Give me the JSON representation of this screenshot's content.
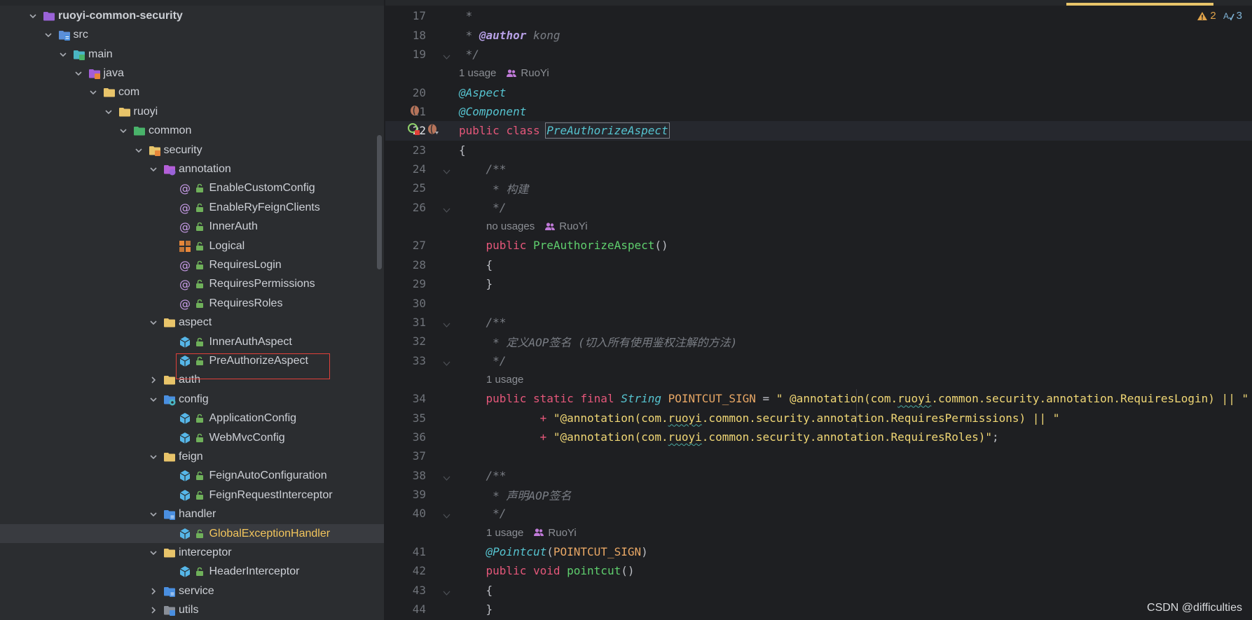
{
  "project_tree": {
    "rows": [
      {
        "depth": 2,
        "expanded": true,
        "icon": "module-icon",
        "label": "ruoyi-common-security",
        "bold": true
      },
      {
        "depth": 3,
        "expanded": true,
        "icon": "source-root-icon",
        "label": "src"
      },
      {
        "depth": 4,
        "expanded": true,
        "icon": "folder-main-icon",
        "label": "main"
      },
      {
        "depth": 5,
        "expanded": true,
        "icon": "java-source-icon",
        "label": "java"
      },
      {
        "depth": 6,
        "expanded": true,
        "icon": "package-icon",
        "label": "com"
      },
      {
        "depth": 7,
        "expanded": true,
        "icon": "package-icon",
        "label": "ruoyi"
      },
      {
        "depth": 8,
        "expanded": true,
        "icon": "module-package-icon",
        "label": "common"
      },
      {
        "depth": 9,
        "expanded": true,
        "icon": "security-package-icon",
        "label": "security"
      },
      {
        "depth": 10,
        "expanded": true,
        "icon": "annotation-package-icon",
        "label": "annotation"
      },
      {
        "depth": 11,
        "expanded": null,
        "icon": "annotation-icon",
        "label": "EnableCustomConfig",
        "lock": true
      },
      {
        "depth": 11,
        "expanded": null,
        "icon": "annotation-icon",
        "label": "EnableRyFeignClients",
        "lock": true
      },
      {
        "depth": 11,
        "expanded": null,
        "icon": "annotation-icon",
        "label": "InnerAuth",
        "lock": true
      },
      {
        "depth": 11,
        "expanded": null,
        "icon": "enum-icon",
        "label": "Logical",
        "lock": true
      },
      {
        "depth": 11,
        "expanded": null,
        "icon": "annotation-icon",
        "label": "RequiresLogin",
        "lock": true
      },
      {
        "depth": 11,
        "expanded": null,
        "icon": "annotation-icon",
        "label": "RequiresPermissions",
        "lock": true
      },
      {
        "depth": 11,
        "expanded": null,
        "icon": "annotation-icon",
        "label": "RequiresRoles",
        "lock": true
      },
      {
        "depth": 10,
        "expanded": true,
        "icon": "package-icon",
        "label": "aspect"
      },
      {
        "depth": 11,
        "expanded": null,
        "icon": "aspect-class-icon",
        "label": "InnerAuthAspect",
        "lock": true
      },
      {
        "depth": 11,
        "expanded": null,
        "icon": "aspect-class-icon",
        "label": "PreAuthorizeAspect",
        "lock": true
      },
      {
        "depth": 10,
        "expanded": false,
        "icon": "package-icon",
        "label": "auth"
      },
      {
        "depth": 10,
        "expanded": true,
        "icon": "config-package-icon",
        "label": "config"
      },
      {
        "depth": 11,
        "expanded": null,
        "icon": "config-class-icon",
        "label": "ApplicationConfig",
        "lock": true
      },
      {
        "depth": 11,
        "expanded": null,
        "icon": "config-class-icon",
        "label": "WebMvcConfig",
        "lock": true
      },
      {
        "depth": 10,
        "expanded": true,
        "icon": "package-icon",
        "label": "feign"
      },
      {
        "depth": 11,
        "expanded": null,
        "icon": "config-class-icon",
        "label": "FeignAutoConfiguration",
        "lock": true
      },
      {
        "depth": 11,
        "expanded": null,
        "icon": "config-class-icon",
        "label": "FeignRequestInterceptor",
        "lock": true
      },
      {
        "depth": 10,
        "expanded": true,
        "icon": "handler-package-icon",
        "label": "handler"
      },
      {
        "depth": 11,
        "expanded": null,
        "icon": "config-class-icon",
        "label": "GlobalExceptionHandler",
        "lock": true,
        "selected": true
      },
      {
        "depth": 10,
        "expanded": true,
        "icon": "package-icon",
        "label": "interceptor"
      },
      {
        "depth": 11,
        "expanded": null,
        "icon": "config-class-icon",
        "label": "HeaderInterceptor",
        "lock": true
      },
      {
        "depth": 10,
        "expanded": false,
        "icon": "service-package-icon",
        "label": "service"
      },
      {
        "depth": 10,
        "expanded": false,
        "icon": "utils-package-icon",
        "label": "utils"
      }
    ]
  },
  "editor": {
    "inspections": {
      "warnings": "2",
      "typos": "3"
    },
    "watermark": "CSDN @difficulties",
    "lines": [
      {
        "n": "17",
        "tokens": [
          [
            "c-com",
            " *"
          ]
        ]
      },
      {
        "n": "18",
        "tokens": [
          [
            "c-com",
            " * "
          ],
          [
            "c-doc-tag",
            "@author"
          ],
          [
            "c-doc-val",
            " kong"
          ]
        ]
      },
      {
        "n": "19",
        "tokens": [
          [
            "c-com",
            " */"
          ]
        ],
        "fold": true
      },
      {
        "hint": "1 usage",
        "author": "RuoYi",
        "indent": 0
      },
      {
        "n": "20",
        "tokens": [
          [
            "c-ann",
            "@Aspect"
          ]
        ]
      },
      {
        "n": "21",
        "tokens": [
          [
            "c-ann",
            "@Component"
          ]
        ],
        "gutter": "bean"
      },
      {
        "n": "22",
        "tokens": [
          [
            "c-kw",
            "public "
          ],
          [
            "c-kw",
            "class "
          ],
          [
            "c-cls boxed",
            "PreAuthorizeAspect"
          ]
        ],
        "current": true,
        "gutter": "run"
      },
      {
        "n": "23",
        "tokens": [
          [
            "c-plain",
            "{"
          ]
        ]
      },
      {
        "n": "24",
        "tokens": [
          [
            "c-com",
            "    /**"
          ]
        ],
        "fold": true
      },
      {
        "n": "25",
        "tokens": [
          [
            "c-com",
            "     * 构建"
          ]
        ]
      },
      {
        "n": "26",
        "tokens": [
          [
            "c-com",
            "     */"
          ]
        ],
        "fold": true
      },
      {
        "hint": "no usages",
        "author": "RuoYi",
        "indent": 1
      },
      {
        "n": "27",
        "tokens": [
          [
            "c-kw",
            "    public "
          ],
          [
            "c-meth",
            "PreAuthorizeAspect"
          ],
          [
            "c-plain",
            "()"
          ]
        ]
      },
      {
        "n": "28",
        "tokens": [
          [
            "c-plain",
            "    {"
          ]
        ]
      },
      {
        "n": "29",
        "tokens": [
          [
            "c-plain",
            "    }"
          ]
        ]
      },
      {
        "n": "30",
        "tokens": [
          [
            "c-plain",
            ""
          ]
        ]
      },
      {
        "n": "31",
        "tokens": [
          [
            "c-com",
            "    /**"
          ]
        ],
        "fold": true
      },
      {
        "n": "32",
        "tokens": [
          [
            "c-com",
            "     * 定义AOP签名 (切入所有使用鉴权注解的方法)"
          ]
        ]
      },
      {
        "n": "33",
        "tokens": [
          [
            "c-com",
            "     */"
          ]
        ],
        "fold": true
      },
      {
        "hint": "1 usage",
        "author": "",
        "indent": 1
      },
      {
        "n": "34",
        "tokens": [
          [
            "c-kw",
            "    public "
          ],
          [
            "c-kw",
            "static "
          ],
          [
            "c-kw",
            "final "
          ],
          [
            "c-type",
            "String "
          ],
          [
            "c-const",
            "POINTCUT_SIGN"
          ],
          [
            "c-plain",
            " = "
          ],
          [
            "c-str",
            "\" @annotation(com."
          ],
          [
            "c-str c-squig",
            "ruoyi"
          ],
          [
            "c-str",
            ".common.security.annotation.RequiresLogin) || \""
          ]
        ]
      },
      {
        "n": "35",
        "tokens": [
          [
            "c-plain",
            "            "
          ],
          [
            "c-kw",
            "+ "
          ],
          [
            "c-str",
            "\"@annotation(com."
          ],
          [
            "c-str c-squig",
            "ruoyi"
          ],
          [
            "c-str",
            ".common.security.annotation.RequiresPermissions) || \""
          ]
        ]
      },
      {
        "n": "36",
        "tokens": [
          [
            "c-plain",
            "            "
          ],
          [
            "c-kw",
            "+ "
          ],
          [
            "c-str",
            "\"@annotation(com."
          ],
          [
            "c-str c-squig",
            "ruoyi"
          ],
          [
            "c-str",
            ".common.security.annotation.RequiresRoles)\""
          ],
          [
            "c-plain",
            ";"
          ]
        ]
      },
      {
        "n": "37",
        "tokens": [
          [
            "c-plain",
            ""
          ]
        ]
      },
      {
        "n": "38",
        "tokens": [
          [
            "c-com",
            "    /**"
          ]
        ],
        "fold": true
      },
      {
        "n": "39",
        "tokens": [
          [
            "c-com",
            "     * 声明AOP签名"
          ]
        ]
      },
      {
        "n": "40",
        "tokens": [
          [
            "c-com",
            "     */"
          ]
        ],
        "fold": true
      },
      {
        "hint": "1 usage",
        "author": "RuoYi",
        "indent": 1
      },
      {
        "n": "41",
        "tokens": [
          [
            "c-ann",
            "    @Pointcut"
          ],
          [
            "c-plain",
            "("
          ],
          [
            "c-const",
            "POINTCUT_SIGN"
          ],
          [
            "c-plain",
            ")"
          ]
        ]
      },
      {
        "n": "42",
        "tokens": [
          [
            "c-kw",
            "    public "
          ],
          [
            "c-kw",
            "void "
          ],
          [
            "c-meth",
            "pointcut"
          ],
          [
            "c-plain",
            "()"
          ]
        ]
      },
      {
        "n": "43",
        "tokens": [
          [
            "c-plain",
            "    {"
          ]
        ],
        "fold": true
      },
      {
        "n": "44",
        "tokens": [
          [
            "c-plain",
            "    }"
          ]
        ]
      }
    ]
  }
}
